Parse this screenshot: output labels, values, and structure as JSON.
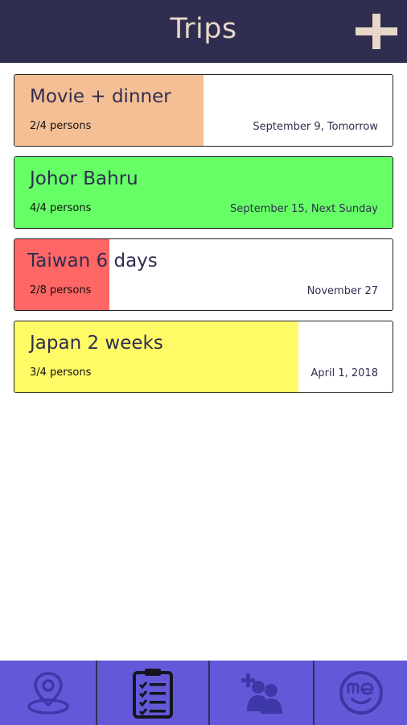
{
  "header": {
    "title": "Trips",
    "add_icon": "plus-icon"
  },
  "trips": [
    {
      "name": "Movie + dinner",
      "persons": "2/4 persons",
      "date": "September 9, Tomorrow",
      "fill_fraction": 0.5,
      "color": "#f5bf95"
    },
    {
      "name": "Johor Bahru",
      "persons": "4/4 persons",
      "date": "September 15, Next Sunday",
      "fill_fraction": 1.0,
      "color": "#66ff66"
    },
    {
      "name": "Taiwan 6 days",
      "persons": "2/8 persons",
      "date": "November 27",
      "fill_fraction": 0.25,
      "color": "#ff6666"
    },
    {
      "name": "Japan 2 weeks",
      "persons": "3/4 persons",
      "date": "April 1, 2018",
      "fill_fraction": 0.75,
      "color": "#fffa66"
    }
  ],
  "bottom_nav": {
    "items": [
      {
        "icon": "location-pin-icon",
        "active": false
      },
      {
        "icon": "checklist-icon",
        "active": true
      },
      {
        "icon": "add-group-icon",
        "active": false
      },
      {
        "icon": "me-profile-icon",
        "active": false
      }
    ]
  },
  "colors": {
    "header_bg": "#2f2e50",
    "nav_bg": "#6359d8",
    "nav_icon": "#3d37a8",
    "title": "#e8d8c8"
  }
}
